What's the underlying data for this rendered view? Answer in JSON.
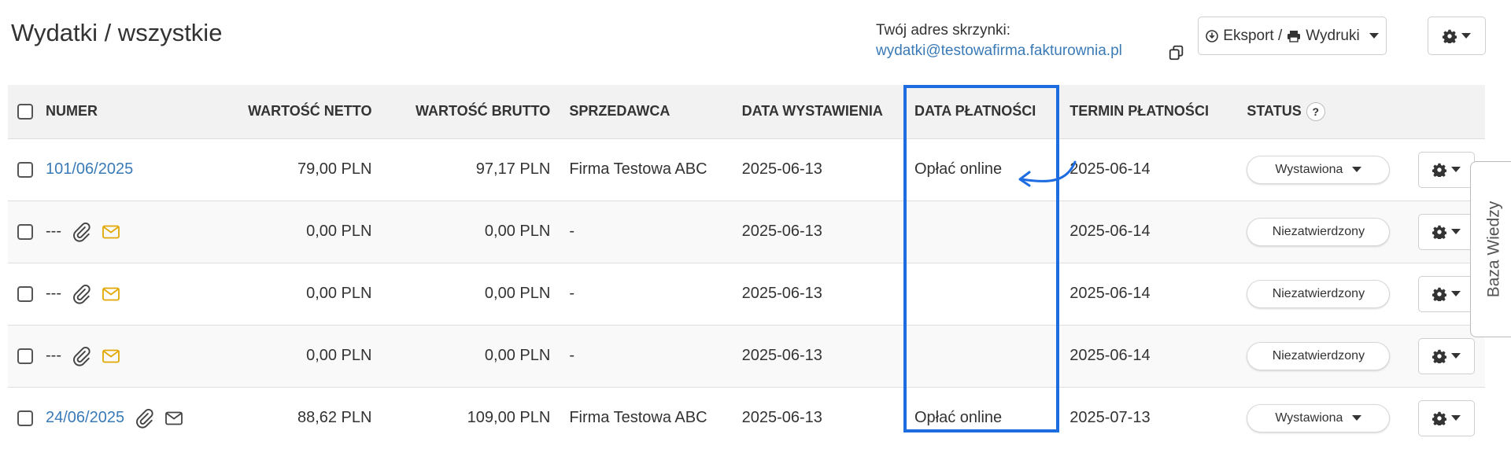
{
  "header": {
    "title": "Wydatki / wszystkie",
    "mailbox_label": "Twój adres skrzynki:",
    "mailbox_email": "wydatki@testowafirma.fakturownia.pl",
    "export_label": "Eksport /",
    "print_label": "Wydruki"
  },
  "table": {
    "columns": {
      "numer": "NUMER",
      "netto": "WARTOŚĆ NETTO",
      "brutto": "WARTOŚĆ BRUTTO",
      "seller": "SPRZEDAWCA",
      "issue_date": "DATA WYSTAWIENIA",
      "payment_date": "DATA PŁATNOŚCI",
      "due_date": "TERMIN PŁATNOŚCI",
      "status": "STATUS",
      "status_help": "?"
    },
    "rows": [
      {
        "number": "101/06/2025",
        "netto": "79,00 PLN",
        "brutto": "97,17 PLN",
        "seller": "Firma Testowa ABC",
        "issue_date": "2025-06-13",
        "payment": "Opłać online",
        "due": "2025-06-14",
        "status": "Wystawiona"
      },
      {
        "number": "---",
        "netto": "0,00 PLN",
        "brutto": "0,00 PLN",
        "seller": "-",
        "issue_date": "2025-06-13",
        "payment": "",
        "due": "2025-06-14",
        "status": "Niezatwierdzony"
      },
      {
        "number": "---",
        "netto": "0,00 PLN",
        "brutto": "0,00 PLN",
        "seller": "-",
        "issue_date": "2025-06-13",
        "payment": "",
        "due": "2025-06-14",
        "status": "Niezatwierdzony"
      },
      {
        "number": "---",
        "netto": "0,00 PLN",
        "brutto": "0,00 PLN",
        "seller": "-",
        "issue_date": "2025-06-13",
        "payment": "",
        "due": "2025-06-14",
        "status": "Niezatwierdzony"
      },
      {
        "number": "24/06/2025",
        "netto": "88,62 PLN",
        "brutto": "109,00 PLN",
        "seller": "Firma Testowa ABC",
        "issue_date": "2025-06-13",
        "payment": "Opłać online",
        "due": "2025-07-13",
        "status": "Wystawiona"
      }
    ]
  },
  "side_tab": {
    "label": "Baza Wiedzy"
  },
  "colors": {
    "accent_link": "#3a7ab7",
    "highlight": "#1e6de0",
    "envelope_yellow": "#e0a800"
  },
  "icons": [
    "copy-icon",
    "download-icon",
    "printer-icon",
    "gear-icon",
    "paperclip-icon",
    "envelope-icon",
    "caret-down-icon",
    "checkbox"
  ]
}
